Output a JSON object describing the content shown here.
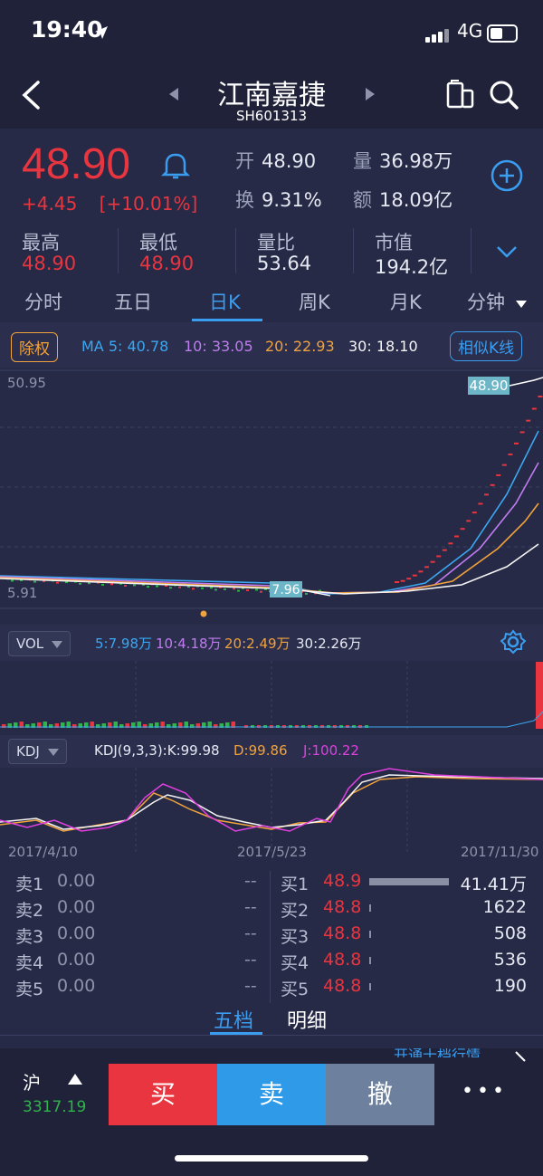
{
  "status": {
    "time": "19:40",
    "network": "4G"
  },
  "header": {
    "title": "江南嘉捷",
    "code": "SH601313"
  },
  "quote": {
    "price": "48.90",
    "change": "+4.45",
    "change_pct": "[+10.01%]",
    "open_label": "开",
    "open_value": "48.90",
    "volume_label": "量",
    "volume_value": "36.98万",
    "turnover_label": "换",
    "turnover_value": "9.31%",
    "amount_label": "额",
    "amount_value": "18.09亿",
    "high_label": "最高",
    "high_value": "48.90",
    "low_label": "最低",
    "low_value": "48.90",
    "volratio_label": "量比",
    "volratio_value": "53.64",
    "mktcap_label": "市值",
    "mktcap_value": "194.2亿"
  },
  "tabs": [
    "分时",
    "五日",
    "日K",
    "周K",
    "月K",
    "分钟"
  ],
  "active_tab": "日K",
  "ma_row": {
    "adjust_label": "除权",
    "ma5": "MA 5: 40.78",
    "ma10": "10: 33.05",
    "ma20": "20: 22.93",
    "ma30": "30: 18.10",
    "similar_label": "相似K线"
  },
  "chart_data": {
    "type": "line",
    "y_max_label": "50.95",
    "y_min_label": "5.91",
    "last_price_label": "48.90",
    "low_label": "7.96",
    "grid": true,
    "colors": {
      "ma5": "#3ba7f0",
      "ma10": "#c07bf0",
      "ma20": "#f0a23c",
      "ma30": "#f5f5f5",
      "up": "#e8353f",
      "down": "#2fb34a"
    }
  },
  "vol": {
    "label": "VOL",
    "ma5": "5:7.98万",
    "ma10": "10:4.18万",
    "ma20": "20:2.49万",
    "ma30": "30:2.26万"
  },
  "kdj": {
    "label": "KDJ",
    "params": "KDJ(9,3,3):K:99.98",
    "d": "D:99.86",
    "j": "J:100.22"
  },
  "dates": [
    "2017/4/10",
    "2017/5/23",
    "2017/11/30"
  ],
  "order_book": {
    "asks": [
      {
        "label": "卖1",
        "price": "0.00",
        "vol": "--"
      },
      {
        "label": "卖2",
        "price": "0.00",
        "vol": "--"
      },
      {
        "label": "卖3",
        "price": "0.00",
        "vol": "--"
      },
      {
        "label": "卖4",
        "price": "0.00",
        "vol": "--"
      },
      {
        "label": "卖5",
        "price": "0.00",
        "vol": "--"
      }
    ],
    "bids": [
      {
        "label": "买1",
        "price": "48.9",
        "vol": "41.41万",
        "bar_fraction": 1.0
      },
      {
        "label": "买2",
        "price": "48.8",
        "vol": "1622",
        "bar_fraction": 0.02
      },
      {
        "label": "买3",
        "price": "48.8",
        "vol": "508",
        "bar_fraction": 0.01
      },
      {
        "label": "买4",
        "price": "48.8",
        "vol": "536",
        "bar_fraction": 0.01
      },
      {
        "label": "买5",
        "price": "48.8",
        "vol": "190",
        "bar_fraction": 0.005
      }
    ]
  },
  "bottom_tabs": {
    "five": "五档",
    "detail": "明细",
    "upgrade": "开通十档行情"
  },
  "index": {
    "name": "沪",
    "value": "3317.19"
  },
  "actions": {
    "buy": "买",
    "sell": "卖",
    "cancel": "撤",
    "more": "•••"
  }
}
